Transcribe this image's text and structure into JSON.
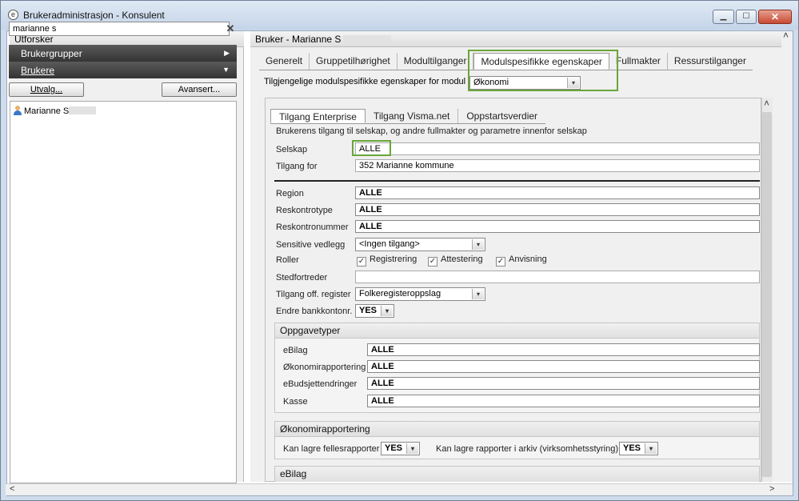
{
  "window": {
    "title": "Brukeradministrasjon - Konsulent",
    "app_icon_glyph": "e",
    "min_glyph": "▁",
    "max_glyph": "☐",
    "close_glyph": "✕"
  },
  "left_pane": {
    "header": "Utforsker",
    "search_value": "marianne s",
    "search_clear": "✕",
    "nav_groups": [
      "Brukergrupper",
      "Brukere"
    ],
    "buttons": {
      "utvalg": "Utvalg...",
      "avansert": "Avansert..."
    },
    "users": [
      "Marianne S"
    ]
  },
  "right_pane": {
    "header": "Bruker - Marianne S",
    "tabs": [
      "Generelt",
      "Gruppetilhørighet",
      "Modultilganger",
      "Modulspesifikke egenskaper",
      "Fullmakter",
      "Ressurstilganger"
    ],
    "active_tab": "Modulspesifikke egenskaper",
    "module_label": "Tilgjengelige modulspesifikke egenskaper for modul",
    "module_value": "Økonomi",
    "sub_tabs": [
      "Tilgang Enterprise",
      "Tilgang Visma.net",
      "Oppstartsverdier"
    ],
    "active_sub_tab": "Tilgang Enterprise",
    "description": "Brukerens tilgang til selskap, og andre fullmakter og parametre innenfor selskap",
    "fields": {
      "selskap": {
        "label": "Selskap",
        "value": "ALLE"
      },
      "tilgang_for": {
        "label": "Tilgang for",
        "value": "352 Marianne kommune"
      },
      "region": {
        "label": "Region",
        "value": "ALLE"
      },
      "reskontrotype": {
        "label": "Reskontrotype",
        "value": "ALLE"
      },
      "reskontronummer": {
        "label": "Reskontronummer",
        "value": "ALLE"
      },
      "sensitive_vedlegg": {
        "label": "Sensitive vedlegg",
        "value": "<Ingen tilgang>"
      },
      "roller": {
        "label": "Roller",
        "options": [
          {
            "label": "Registrering",
            "checked": true
          },
          {
            "label": "Attestering",
            "checked": true
          },
          {
            "label": "Anvisning",
            "checked": true
          }
        ]
      },
      "stedfortreder": {
        "label": "Stedfortreder",
        "value": ""
      },
      "tilgang_off_register": {
        "label": "Tilgang off. register",
        "value": "Folkeregisteroppslag"
      },
      "endre_bankkontonr": {
        "label": "Endre bankkontonr.",
        "value": "YES"
      }
    },
    "oppgavetyper": {
      "title": "Oppgavetyper",
      "rows": [
        {
          "label": "eBilag",
          "value": "ALLE"
        },
        {
          "label": "Økonomirapportering",
          "value": "ALLE"
        },
        {
          "label": "eBudsjettendringer",
          "value": "ALLE"
        },
        {
          "label": "Kasse",
          "value": "ALLE"
        }
      ]
    },
    "okonomirapportering": {
      "title": "Økonomirapportering",
      "fellesrapporter_label": "Kan lagre fellesrapporter",
      "fellesrapporter_value": "YES",
      "arkiv_label": "Kan lagre rapporter i arkiv (virksomhetsstyring)",
      "arkiv_value": "YES"
    },
    "ebilag_group_title": "eBilag"
  },
  "glyphs": {
    "check": "✓",
    "dropdown": "▾",
    "up": "˄",
    "down": "˅",
    "left": "<",
    "right": ">",
    "nav_collapsed": "▶",
    "nav_expanded": "▼"
  },
  "colors": {
    "highlight": "#6aa63a",
    "nav_bg": "#3d3d3d"
  }
}
